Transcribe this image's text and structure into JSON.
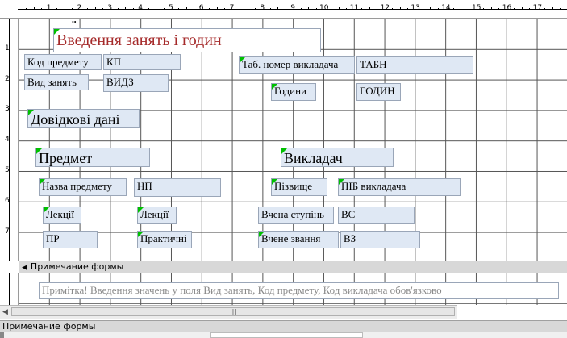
{
  "ruler": {
    "numbers": [
      "1",
      "2",
      "3",
      "4",
      "5",
      "6",
      "7",
      "8",
      "9",
      "10",
      "11",
      "12",
      "13",
      "14",
      "15",
      "16",
      "17"
    ],
    "left_numbers": [
      "1",
      "2",
      "3",
      "4",
      "5",
      "6",
      "7"
    ]
  },
  "form": {
    "title": "Введення занять і годин",
    "labels": {
      "subject_code": "Код предмету",
      "lesson_type": "Вид занять",
      "teacher_number": "Таб. номер викладача",
      "hours": "Години",
      "reference": "Довідкові дані",
      "subject_section": "Предмет",
      "teacher_section": "Викладач",
      "subject_name": "Назва предмету",
      "lectures": "Лекції",
      "lectures_2": "Лекції",
      "practical": "Практичні",
      "surname": "Пізвище",
      "degree": "Вчена ступінь",
      "rank": "Вчене звання"
    },
    "fields": {
      "kp": "КП",
      "vidz": "ВИДЗ",
      "tabn": "ТАБН",
      "godyn": "ГОДИН",
      "np": "НП",
      "pib": "ПІБ викладача",
      "vs": "ВС",
      "pr": "ПР",
      "vz": "ВЗ"
    }
  },
  "footer": {
    "section_label": "Примечание формы",
    "note": "Примітка! Введення значень у поля Вид занять, Код предмету, Код викладача обов'язково",
    "bottom_label": "Примечание формы"
  }
}
